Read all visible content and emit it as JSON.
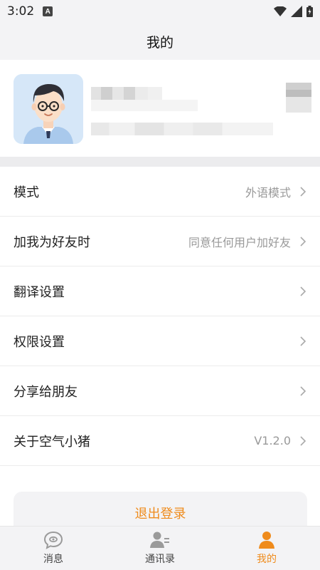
{
  "status_bar": {
    "time": "3:02",
    "badge": "A"
  },
  "header": {
    "title": "我的"
  },
  "settings": [
    {
      "label": "模式",
      "value": "外语模式"
    },
    {
      "label": "加我为好友时",
      "value": "同意任何用户加好友"
    },
    {
      "label": "翻译设置",
      "value": ""
    },
    {
      "label": "权限设置",
      "value": ""
    },
    {
      "label": "分享给朋友",
      "value": ""
    },
    {
      "label": "关于空气小猪",
      "value": "V1.2.0"
    }
  ],
  "logout": {
    "label": "退出登录"
  },
  "tabbar": {
    "tabs": [
      {
        "label": "消息"
      },
      {
        "label": "通讯录"
      },
      {
        "label": "我的"
      }
    ]
  },
  "colors": {
    "accent": "#ef8b1c",
    "inactive": "#999999"
  }
}
